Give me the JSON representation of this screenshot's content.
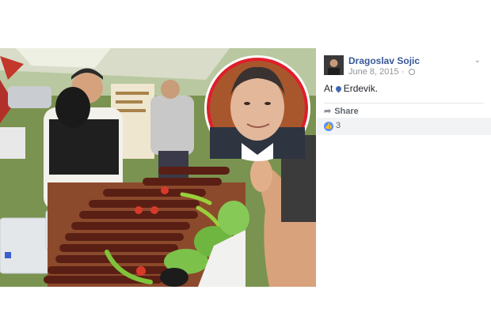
{
  "post": {
    "author": "Dragoslav Sojic",
    "date": "June 8, 2015",
    "separator": "·",
    "location_prefix": "At",
    "location": "Erdevik.",
    "share_label": "Share",
    "like_count": "3",
    "menu_icon": "chevron-down-icon",
    "privacy_icon": "globe-icon"
  },
  "colors": {
    "author_link": "#365899",
    "like_blue": "#5890ff",
    "inset_ring": "#e11d2a"
  }
}
